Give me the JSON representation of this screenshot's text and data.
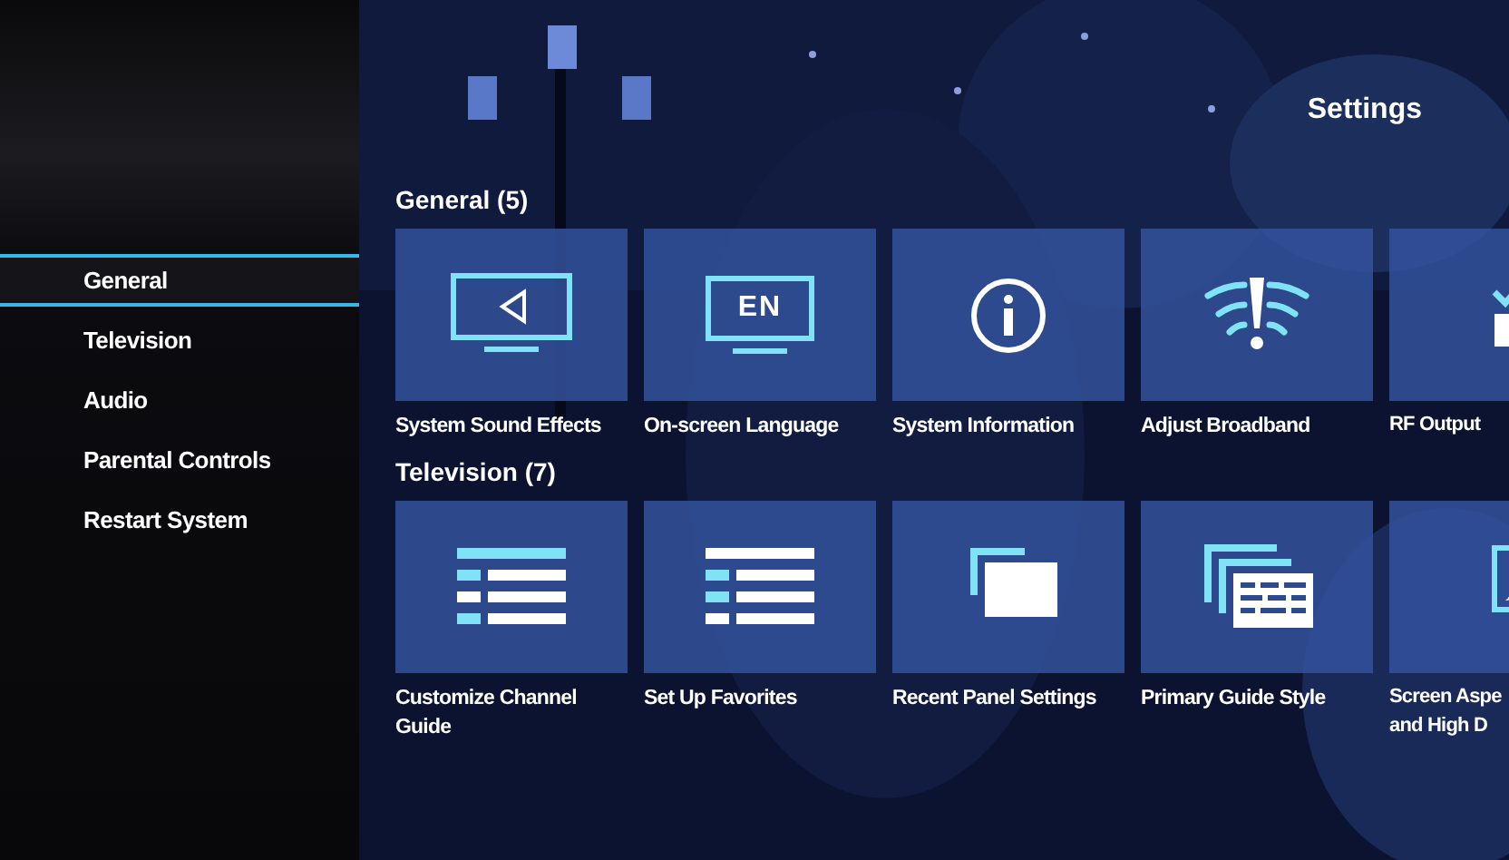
{
  "title": "Settings",
  "sidebar": {
    "items": [
      {
        "label": "General",
        "selected": true
      },
      {
        "label": "Television",
        "selected": false
      },
      {
        "label": "Audio",
        "selected": false
      },
      {
        "label": "Parental Controls",
        "selected": false
      },
      {
        "label": "Restart System",
        "selected": false
      }
    ]
  },
  "sections": [
    {
      "heading": "General (5)",
      "tiles": [
        {
          "kind": "sound",
          "label": "System Sound Effects"
        },
        {
          "kind": "language",
          "label": "On-screen Language",
          "icon_text": "EN"
        },
        {
          "kind": "info",
          "label": "System Information"
        },
        {
          "kind": "broadband",
          "label": "Adjust Broadband"
        },
        {
          "kind": "rf",
          "label": "RF Output"
        }
      ]
    },
    {
      "heading": "Television (7)",
      "tiles": [
        {
          "kind": "list_a",
          "label": "Customize Channel Guide"
        },
        {
          "kind": "list_b",
          "label": "Set Up Favorites"
        },
        {
          "kind": "panels",
          "label": "Recent Panel Settings"
        },
        {
          "kind": "guide",
          "label": "Primary Guide Style"
        },
        {
          "kind": "aspect",
          "label": "Screen Aspe and High D"
        }
      ]
    }
  ]
}
